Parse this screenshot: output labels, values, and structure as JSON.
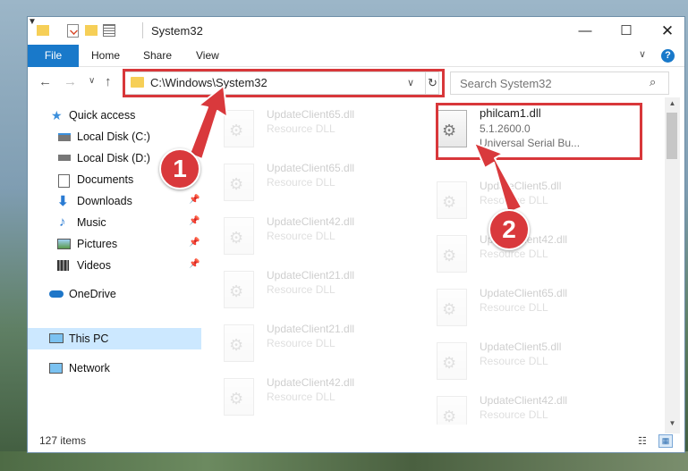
{
  "window": {
    "title": "System32",
    "controls": {
      "minimize": "—",
      "maximize": "☐",
      "close": "✕"
    }
  },
  "ribbon": {
    "tabs": [
      "File",
      "Home",
      "Share",
      "View"
    ],
    "help": "?"
  },
  "navigation": {
    "address": "C:\\Windows\\System32",
    "search_placeholder": "Search System32"
  },
  "nav_pane": {
    "items": [
      {
        "label": "Quick access",
        "icon": "star-icon"
      },
      {
        "label": "Local Disk (C:)",
        "icon": "drive-icon"
      },
      {
        "label": "Local Disk (D:)",
        "icon": "drive-icon"
      },
      {
        "label": "Documents",
        "icon": "documents-icon",
        "pinned": true
      },
      {
        "label": "Downloads",
        "icon": "download-icon",
        "pinned": true
      },
      {
        "label": "Music",
        "icon": "music-icon",
        "pinned": true
      },
      {
        "label": "Pictures",
        "icon": "pictures-icon",
        "pinned": true
      },
      {
        "label": "Videos",
        "icon": "videos-icon",
        "pinned": true
      },
      {
        "label": "OneDrive",
        "icon": "cloud-icon"
      },
      {
        "label": "This PC",
        "icon": "computer-icon",
        "selected": true
      },
      {
        "label": "Network",
        "icon": "network-icon"
      }
    ]
  },
  "files": {
    "selected": {
      "name": "philcam1.dll",
      "version": "5.1.2600.0",
      "description": "Universal Serial Bu..."
    },
    "left_column": [
      {
        "name": "UpdateClient65.dll",
        "type": "Resource DLL"
      },
      {
        "name": "UpdateClient65.dll",
        "type": "Resource DLL"
      },
      {
        "name": "UpdateClient42.dll",
        "type": "Resource DLL"
      },
      {
        "name": "UpdateClient21.dll",
        "type": "Resource DLL"
      },
      {
        "name": "UpdateClient21.dll",
        "type": "Resource DLL"
      },
      {
        "name": "UpdateClient42.dll",
        "type": "Resource DLL"
      }
    ],
    "right_column": [
      {
        "name": "UpdateClient5.dll",
        "type": "Resource DLL"
      },
      {
        "name": "UpdateClient42.dll",
        "type": "Resource DLL"
      },
      {
        "name": "UpdateClient65.dll",
        "type": "Resource DLL"
      },
      {
        "name": "UpdateClient5.dll",
        "type": "Resource DLL"
      },
      {
        "name": "UpdateClient42.dll",
        "type": "Resource DLL"
      }
    ]
  },
  "status": {
    "item_count": "127 items"
  },
  "annotations": {
    "badge_1": "1",
    "badge_2": "2",
    "color": "#d8373a"
  }
}
